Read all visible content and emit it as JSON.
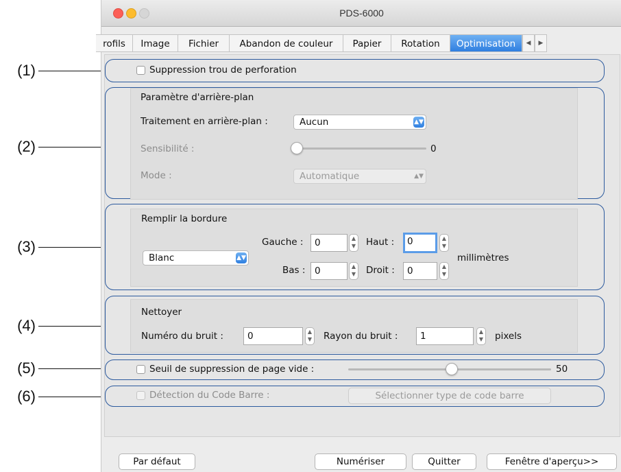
{
  "window": {
    "title": "PDS-6000"
  },
  "tabs": [
    {
      "label": "rofils"
    },
    {
      "label": "Image"
    },
    {
      "label": "Fichier"
    },
    {
      "label": "Abandon de couleur"
    },
    {
      "label": "Papier"
    },
    {
      "label": "Rotation"
    },
    {
      "label": "Optimisation"
    }
  ],
  "active_tab": "Optimisation",
  "callouts": [
    "(1)",
    "(2)",
    "(3)",
    "(4)",
    "(5)",
    "(6)"
  ],
  "punch_hole": {
    "label": "Suppression trou de perforation",
    "checked": false
  },
  "background": {
    "heading": "Paramètre d'arrière-plan",
    "processing_label": "Traitement en arrière-plan :",
    "processing_value": "Aucun",
    "sensitivity_label": "Sensibilité :",
    "sensitivity_value": "0",
    "mode_label": "Mode :",
    "mode_value": "Automatique"
  },
  "border": {
    "heading": "Remplir la bordure",
    "fill_value": "Blanc",
    "left_label": "Gauche :",
    "left_value": "0",
    "top_label": "Haut :",
    "top_value": "0",
    "bottom_label": "Bas :",
    "bottom_value": "0",
    "right_label": "Droit :",
    "right_value": "0",
    "unit": "millimètres"
  },
  "clean": {
    "heading": "Nettoyer",
    "noise_count_label": "Numéro du bruit :",
    "noise_count_value": "0",
    "noise_radius_label": "Rayon du bruit :",
    "noise_radius_value": "1",
    "unit": "pixels"
  },
  "blank_page": {
    "label": "Seuil de suppression de page vide :",
    "value": "50",
    "checked": false
  },
  "barcode": {
    "label": "Détection du Code Barre :",
    "button": "Sélectionner type de code barre",
    "checked": false
  },
  "footer": {
    "default_button": "Par défaut",
    "scan_button": "Numériser",
    "quit_button": "Quitter",
    "preview_button": "Fenêtre d'aperçu>>"
  },
  "colors": {
    "group_border": "#2c5a9e",
    "accent": "#2f7fe0",
    "close": "#fc5f57",
    "minimize": "#fdbc2e"
  }
}
